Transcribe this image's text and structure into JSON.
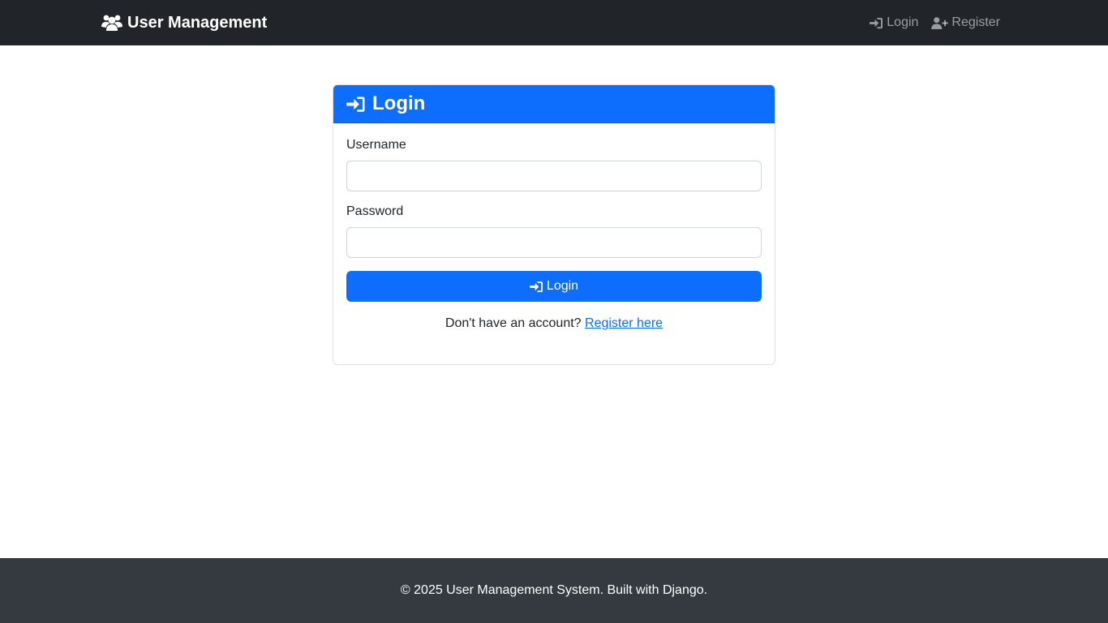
{
  "navbar": {
    "brand_icon": "users-icon",
    "brand_label": "User Management",
    "links": [
      {
        "icon": "sign-in-icon",
        "label": "Login"
      },
      {
        "icon": "user-plus-icon",
        "label": "Register"
      }
    ]
  },
  "login_card": {
    "header_icon": "sign-in-icon",
    "title": "Login",
    "username": {
      "label": "Username",
      "value": "",
      "placeholder": ""
    },
    "password": {
      "label": "Password",
      "value": "",
      "placeholder": ""
    },
    "submit_label": "Login",
    "register_prompt": "Don't have an account?",
    "register_link": "Register here"
  },
  "footer": {
    "text": "© 2025 User Management System. Built with Django."
  },
  "colors": {
    "navbar_bg": "#212529",
    "primary": "#0d6efd",
    "footer_bg": "#343a40"
  }
}
